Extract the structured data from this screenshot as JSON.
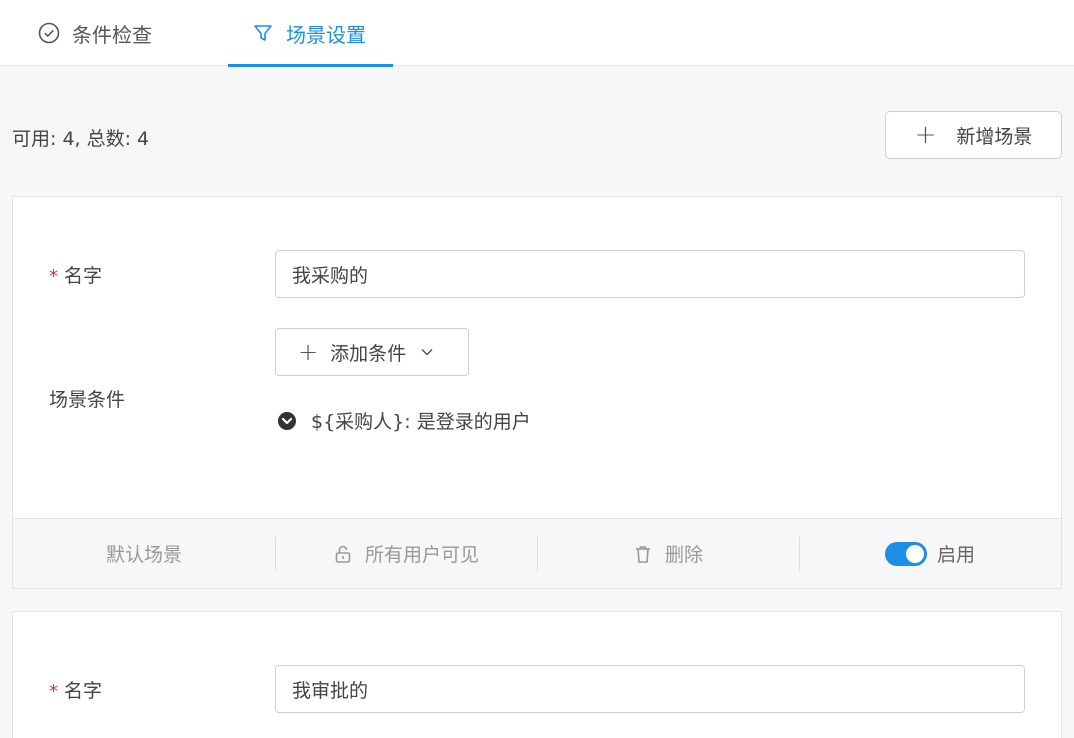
{
  "tabs": [
    {
      "label": "条件检查",
      "icon": "check-circle-icon",
      "active": false
    },
    {
      "label": "场景设置",
      "icon": "filter-icon",
      "active": true
    }
  ],
  "summary": "可用: 4, 总数: 4",
  "add_scene_label": "新增场景",
  "colors": {
    "accent": "#1b8ee8",
    "required": "#e0303b"
  },
  "scenes": [
    {
      "name_label": "名字",
      "name_value": "我采购的",
      "condition_label": "场景条件",
      "add_condition_label": "添加条件",
      "condition_text": "${采购人}: 是登录的用户",
      "footer": {
        "default": "默认场景",
        "visibility": "所有用户可见",
        "delete": "删除",
        "enabled": "启用"
      }
    },
    {
      "name_label": "名字",
      "name_value": "我审批的"
    }
  ]
}
